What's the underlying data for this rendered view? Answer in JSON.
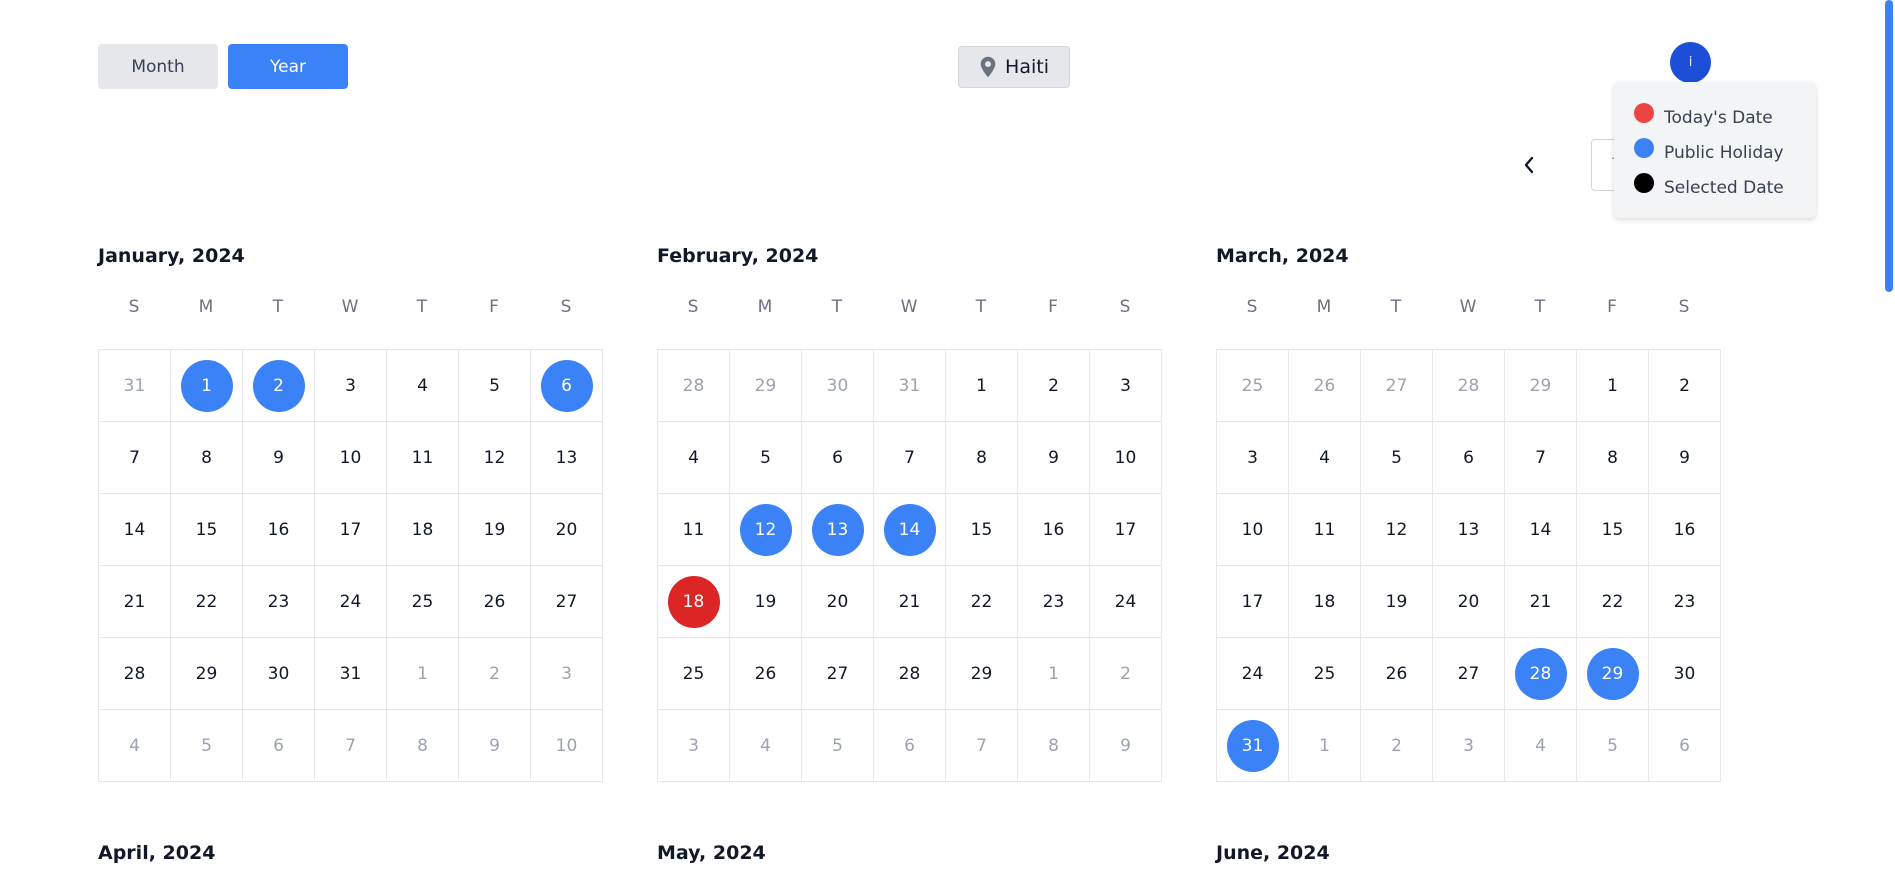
{
  "toolbar": {
    "month_label": "Month",
    "year_label": "Year",
    "active_view": "Year",
    "location": "Haiti",
    "info_label": "i",
    "today_label": "Today"
  },
  "legend": {
    "items": [
      {
        "label": "Today's Date",
        "color": "#ef4444"
      },
      {
        "label": "Public Holiday",
        "color": "#3b82f6"
      },
      {
        "label": "Selected Date",
        "color": "#000000"
      }
    ]
  },
  "colors": {
    "accent": "#3b82f6",
    "today": "#dc2626",
    "info_button": "#1d4ed8"
  },
  "weekday_labels": [
    "S",
    "M",
    "T",
    "W",
    "T",
    "F",
    "S"
  ],
  "months": [
    {
      "title": "January, 2024",
      "weeks": [
        [
          {
            "d": "31",
            "t": "o"
          },
          {
            "d": "1",
            "t": "h"
          },
          {
            "d": "2",
            "t": "h"
          },
          {
            "d": "3"
          },
          {
            "d": "4"
          },
          {
            "d": "5"
          },
          {
            "d": "6",
            "t": "h"
          }
        ],
        [
          {
            "d": "7"
          },
          {
            "d": "8"
          },
          {
            "d": "9"
          },
          {
            "d": "10"
          },
          {
            "d": "11"
          },
          {
            "d": "12"
          },
          {
            "d": "13"
          }
        ],
        [
          {
            "d": "14"
          },
          {
            "d": "15"
          },
          {
            "d": "16"
          },
          {
            "d": "17"
          },
          {
            "d": "18"
          },
          {
            "d": "19"
          },
          {
            "d": "20"
          }
        ],
        [
          {
            "d": "21"
          },
          {
            "d": "22"
          },
          {
            "d": "23"
          },
          {
            "d": "24"
          },
          {
            "d": "25"
          },
          {
            "d": "26"
          },
          {
            "d": "27"
          }
        ],
        [
          {
            "d": "28"
          },
          {
            "d": "29"
          },
          {
            "d": "30"
          },
          {
            "d": "31"
          },
          {
            "d": "1",
            "t": "o"
          },
          {
            "d": "2",
            "t": "o"
          },
          {
            "d": "3",
            "t": "o"
          }
        ],
        [
          {
            "d": "4",
            "t": "o"
          },
          {
            "d": "5",
            "t": "o"
          },
          {
            "d": "6",
            "t": "o"
          },
          {
            "d": "7",
            "t": "o"
          },
          {
            "d": "8",
            "t": "o"
          },
          {
            "d": "9",
            "t": "o"
          },
          {
            "d": "10",
            "t": "o"
          }
        ]
      ]
    },
    {
      "title": "February, 2024",
      "weeks": [
        [
          {
            "d": "28",
            "t": "o"
          },
          {
            "d": "29",
            "t": "o"
          },
          {
            "d": "30",
            "t": "o"
          },
          {
            "d": "31",
            "t": "o"
          },
          {
            "d": "1"
          },
          {
            "d": "2"
          },
          {
            "d": "3"
          }
        ],
        [
          {
            "d": "4"
          },
          {
            "d": "5"
          },
          {
            "d": "6"
          },
          {
            "d": "7"
          },
          {
            "d": "8"
          },
          {
            "d": "9"
          },
          {
            "d": "10"
          }
        ],
        [
          {
            "d": "11"
          },
          {
            "d": "12",
            "t": "h"
          },
          {
            "d": "13",
            "t": "h"
          },
          {
            "d": "14",
            "t": "h"
          },
          {
            "d": "15"
          },
          {
            "d": "16"
          },
          {
            "d": "17"
          }
        ],
        [
          {
            "d": "18",
            "t": "today"
          },
          {
            "d": "19"
          },
          {
            "d": "20"
          },
          {
            "d": "21"
          },
          {
            "d": "22"
          },
          {
            "d": "23"
          },
          {
            "d": "24"
          }
        ],
        [
          {
            "d": "25"
          },
          {
            "d": "26"
          },
          {
            "d": "27"
          },
          {
            "d": "28"
          },
          {
            "d": "29"
          },
          {
            "d": "1",
            "t": "o"
          },
          {
            "d": "2",
            "t": "o"
          }
        ],
        [
          {
            "d": "3",
            "t": "o"
          },
          {
            "d": "4",
            "t": "o"
          },
          {
            "d": "5",
            "t": "o"
          },
          {
            "d": "6",
            "t": "o"
          },
          {
            "d": "7",
            "t": "o"
          },
          {
            "d": "8",
            "t": "o"
          },
          {
            "d": "9",
            "t": "o"
          }
        ]
      ]
    },
    {
      "title": "March, 2024",
      "weeks": [
        [
          {
            "d": "25",
            "t": "o"
          },
          {
            "d": "26",
            "t": "o"
          },
          {
            "d": "27",
            "t": "o"
          },
          {
            "d": "28",
            "t": "o"
          },
          {
            "d": "29",
            "t": "o"
          },
          {
            "d": "1"
          },
          {
            "d": "2"
          }
        ],
        [
          {
            "d": "3"
          },
          {
            "d": "4"
          },
          {
            "d": "5"
          },
          {
            "d": "6"
          },
          {
            "d": "7"
          },
          {
            "d": "8"
          },
          {
            "d": "9"
          }
        ],
        [
          {
            "d": "10"
          },
          {
            "d": "11"
          },
          {
            "d": "12"
          },
          {
            "d": "13"
          },
          {
            "d": "14"
          },
          {
            "d": "15"
          },
          {
            "d": "16"
          }
        ],
        [
          {
            "d": "17"
          },
          {
            "d": "18"
          },
          {
            "d": "19"
          },
          {
            "d": "20"
          },
          {
            "d": "21"
          },
          {
            "d": "22"
          },
          {
            "d": "23"
          }
        ],
        [
          {
            "d": "24"
          },
          {
            "d": "25"
          },
          {
            "d": "26"
          },
          {
            "d": "27"
          },
          {
            "d": "28",
            "t": "h"
          },
          {
            "d": "29",
            "t": "h"
          },
          {
            "d": "30"
          }
        ],
        [
          {
            "d": "31",
            "t": "h"
          },
          {
            "d": "1",
            "t": "o"
          },
          {
            "d": "2",
            "t": "o"
          },
          {
            "d": "3",
            "t": "o"
          },
          {
            "d": "4",
            "t": "o"
          },
          {
            "d": "5",
            "t": "o"
          },
          {
            "d": "6",
            "t": "o"
          }
        ]
      ]
    },
    {
      "title": "April, 2024",
      "weeks": []
    },
    {
      "title": "May, 2024",
      "weeks": []
    },
    {
      "title": "June, 2024",
      "weeks": []
    }
  ]
}
